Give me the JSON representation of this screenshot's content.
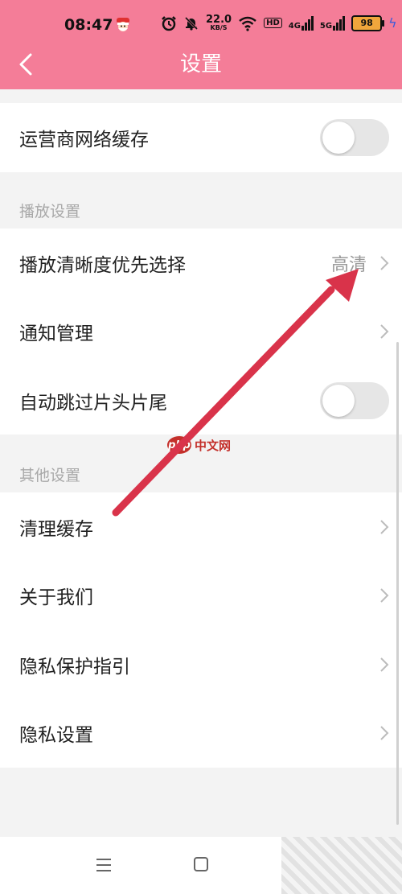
{
  "status_bar": {
    "time": "08:47",
    "net_speed_value": "22.0",
    "net_speed_unit": "KB/S",
    "hd_badge": "HD",
    "signal_1": "4G",
    "signal_2": "5G",
    "battery_level": "98"
  },
  "header": {
    "title": "设置",
    "back_icon": "chevron-left-icon",
    "background_color": "#f47d98"
  },
  "rows": {
    "carrier_cache": {
      "label": "运营商网络缓存",
      "toggle_on": false
    },
    "playback_quality": {
      "label": "播放清晰度优先选择",
      "value": "高清"
    },
    "notification": {
      "label": "通知管理"
    },
    "skip_intro": {
      "label": "自动跳过片头片尾",
      "toggle_on": false
    },
    "clear_cache": {
      "label": "清理缓存"
    },
    "about_us": {
      "label": "关于我们"
    },
    "privacy_guide": {
      "label": "隐私保护指引"
    },
    "privacy_settings": {
      "label": "隐私设置"
    }
  },
  "sections": {
    "playback": "播放设置",
    "other": "其他设置"
  },
  "watermark": {
    "logo": "php",
    "text": "中文网"
  },
  "annotation_color": "#d9334a"
}
